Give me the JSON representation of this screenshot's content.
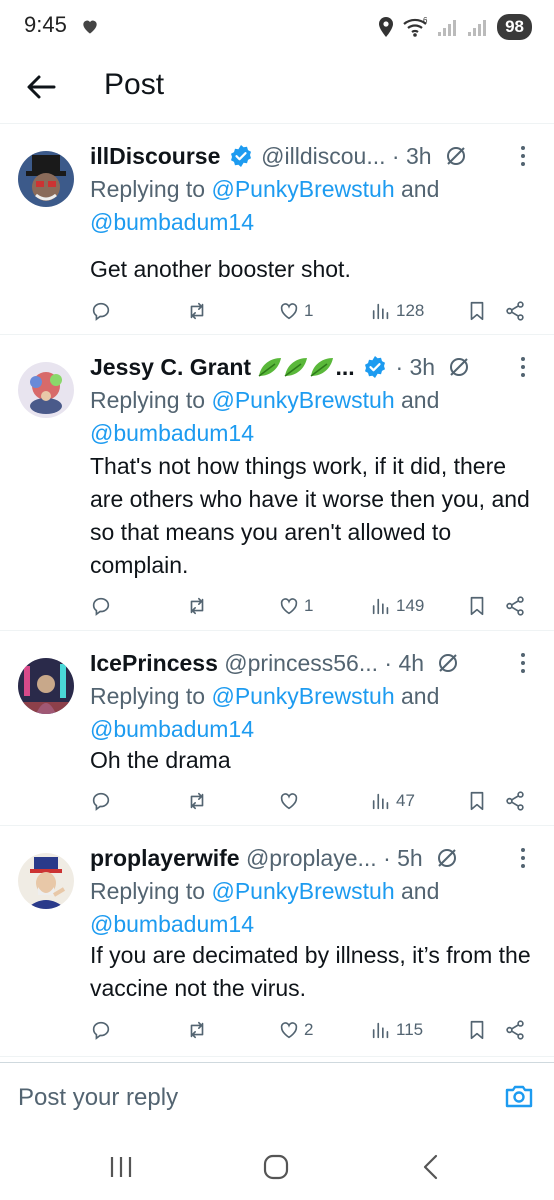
{
  "status_bar": {
    "time": "9:45",
    "network": "6",
    "battery": "98"
  },
  "header": {
    "title": "Post"
  },
  "replies": [
    {
      "name": "illDiscourse",
      "verified": true,
      "handle": "@illdiscou...",
      "time": "· 3h",
      "replying_prefix": "Replying to",
      "mention_1": "@PunkyBrewstuh",
      "and_word": " and",
      "mention_2": "@bumbadum14",
      "text": "Get another booster shot.",
      "likes": "1",
      "views": "128"
    },
    {
      "name": "Jessy C. Grant",
      "name_suffix": "...",
      "verified": true,
      "handle": "",
      "time": "· 3h",
      "replying_prefix": "Replying to",
      "mention_1": "@PunkyBrewstuh",
      "and_word": " and",
      "mention_2": "@bumbadum14",
      "text": "That's not how things work, if it did, there are others who have it worse then you, and so that means you aren't allowed to complain.",
      "likes": "1",
      "views": "149"
    },
    {
      "name": "IcePrincess",
      "verified": false,
      "handle": "@princess56...",
      "time": "· 4h",
      "replying_prefix": "Replying to",
      "mention_1": "@PunkyBrewstuh",
      "and_word": " and",
      "mention_2": "@bumbadum14",
      "text": "Oh the drama",
      "likes": "",
      "views": "47"
    },
    {
      "name": "proplayerwife",
      "verified": false,
      "handle": "@proplaye...",
      "time": "· 5h",
      "replying_prefix": "Replying to",
      "mention_1": "@PunkyBrewstuh",
      "and_word": " and",
      "mention_2": "@bumbadum14",
      "text": "If you are decimated by illness, it’s from the vaccine not the virus.",
      "likes": "2",
      "views": "115"
    }
  ],
  "compose": {
    "placeholder": "Post your reply"
  },
  "icons": {
    "back": "arrow-left-icon",
    "verified": "verified-badge-icon",
    "grok": "grok-icon",
    "more": "more-vertical-icon",
    "reply": "reply-icon",
    "repost": "repost-icon",
    "like": "heart-icon",
    "views": "views-icon",
    "bookmark": "bookmark-icon",
    "share": "share-icon",
    "camera": "camera-icon"
  },
  "colors": {
    "accent": "#1d9bf0",
    "secondary_text": "#536471",
    "divider": "#eff3f4"
  }
}
